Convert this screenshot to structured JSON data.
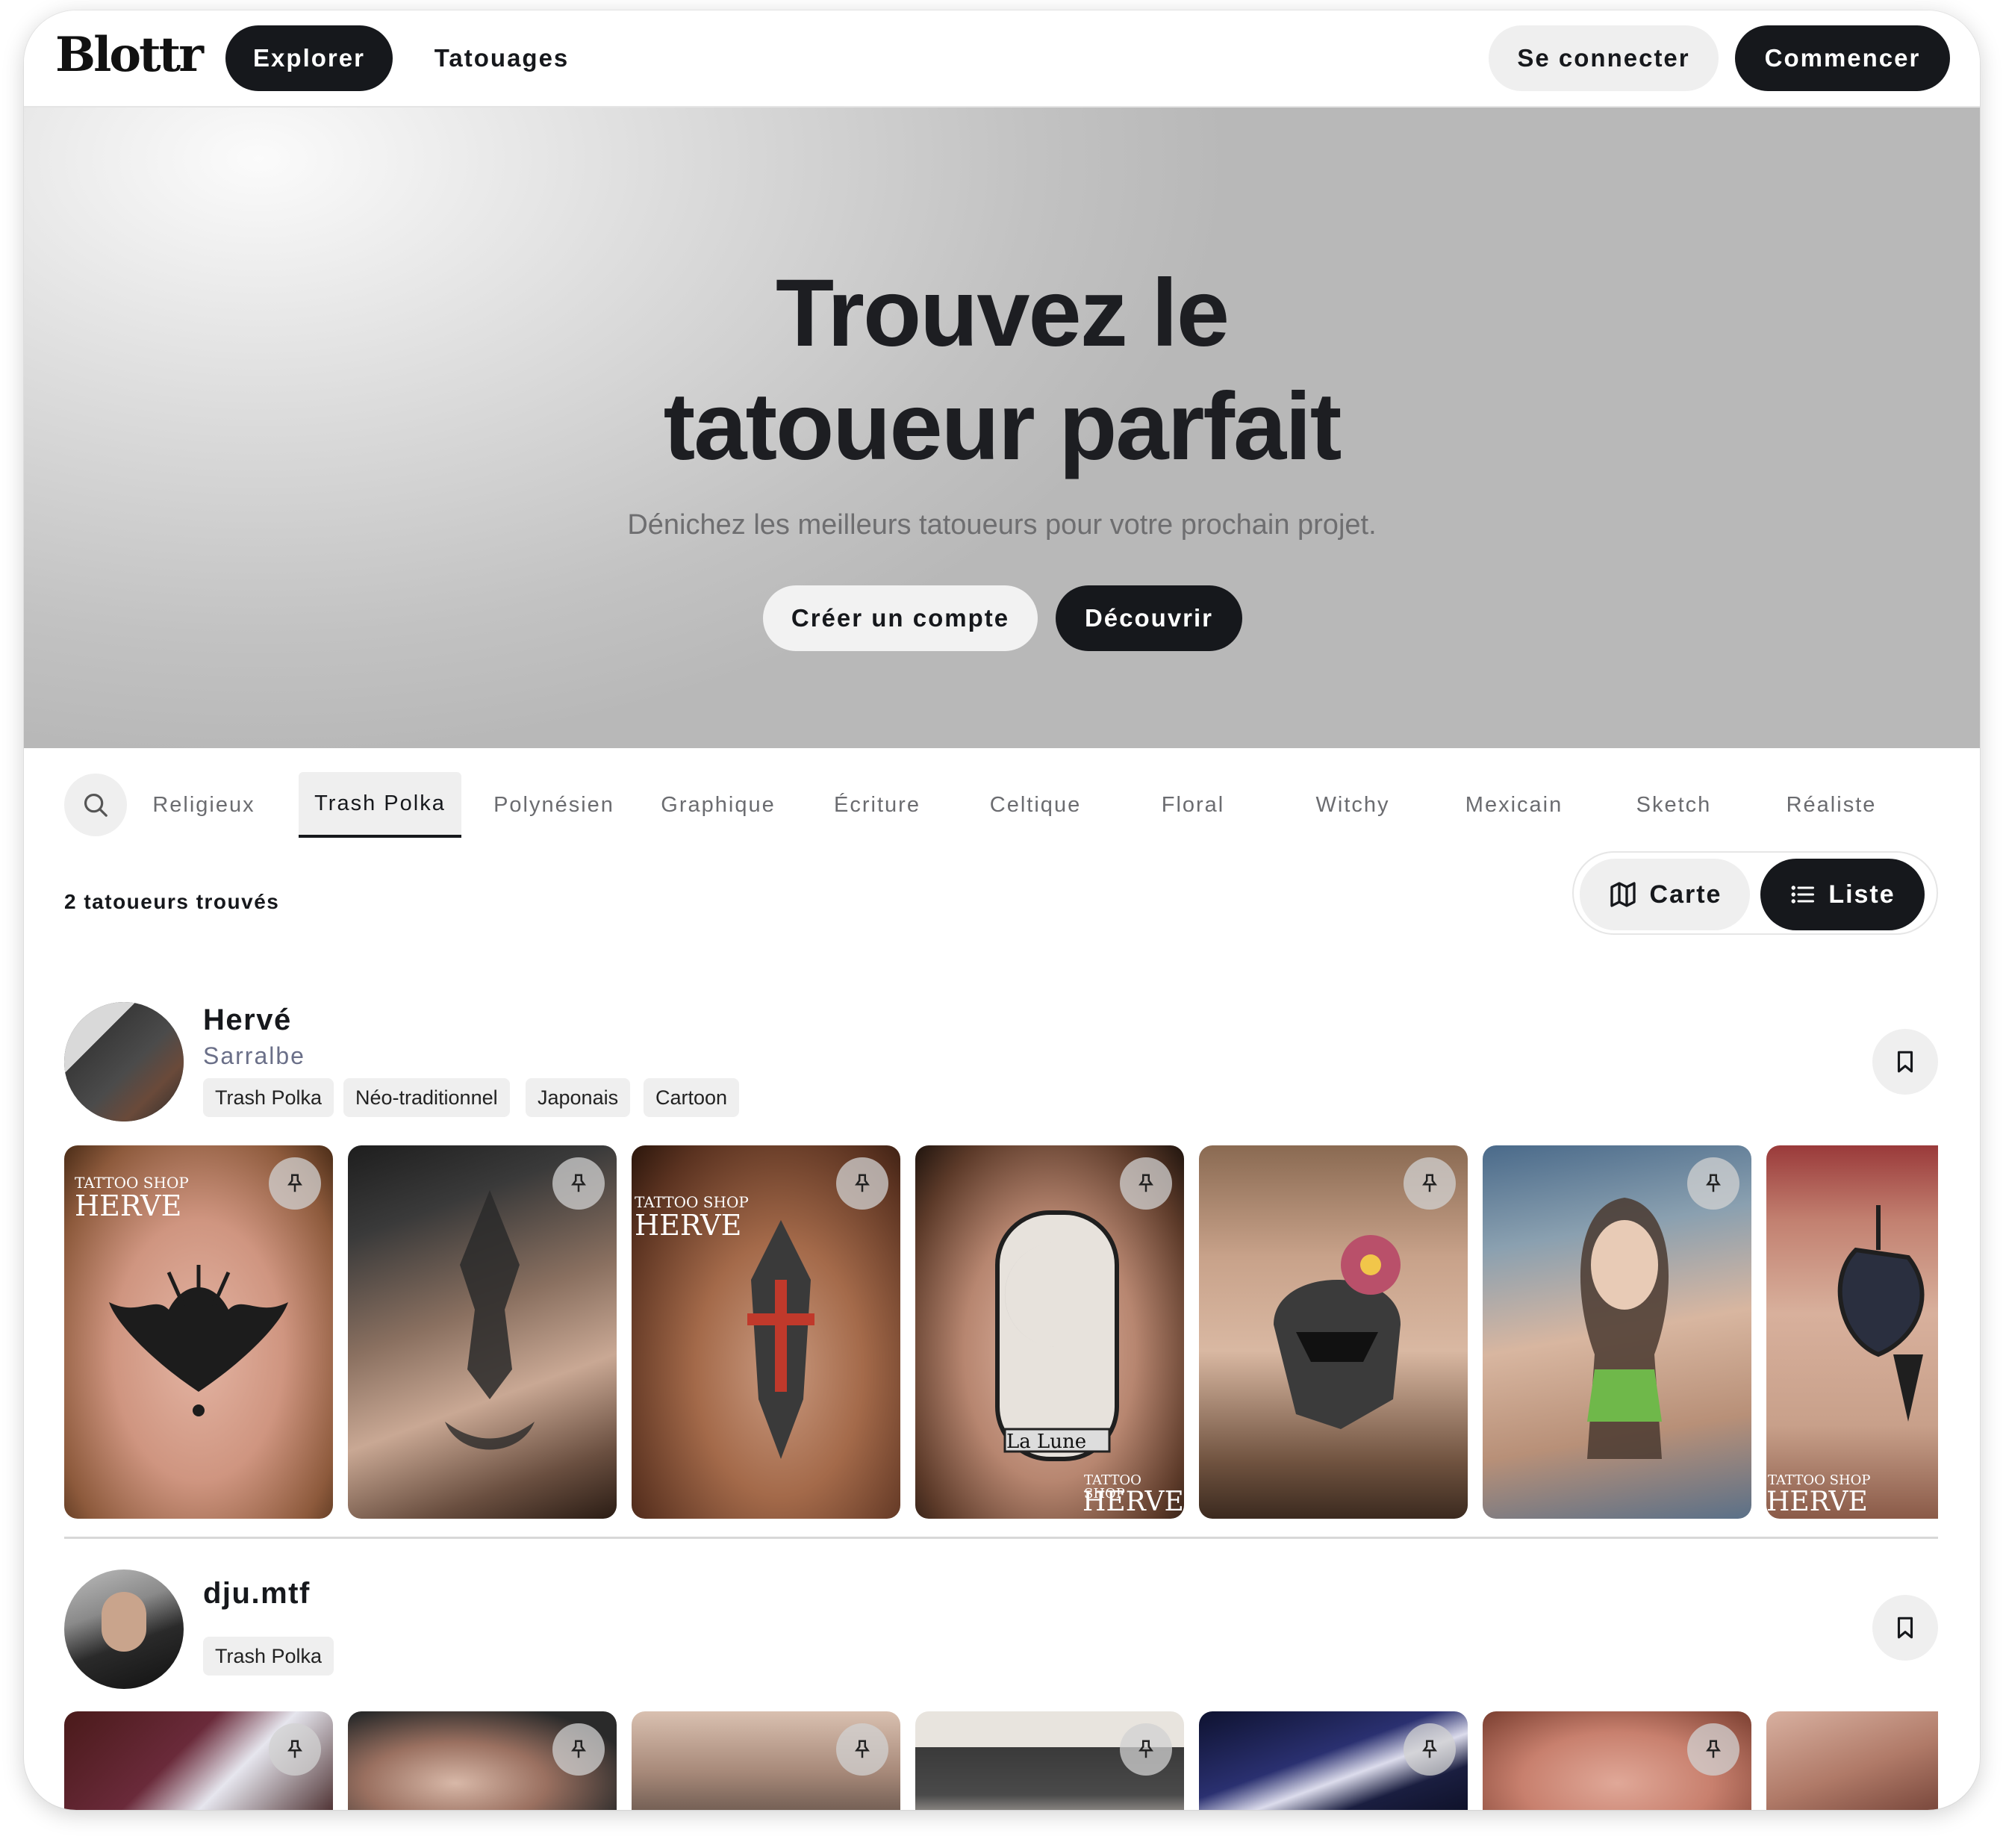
{
  "nav": {
    "logo": "Blottr",
    "explore": "Explorer",
    "tattoos": "Tatouages",
    "login": "Se connecter",
    "start": "Commencer"
  },
  "hero": {
    "title_line1": "Trouvez le",
    "title_line2": "tatoueur parfait",
    "subtitle": "Dénichez les meilleurs tatoueurs pour votre prochain projet.",
    "create_account": "Créer un compte",
    "discover": "Découvrir"
  },
  "categories": {
    "search_icon": "search-icon",
    "items": [
      "Religieux",
      "Trash Polka",
      "Polynésien",
      "Graphique",
      "Écriture",
      "Celtique",
      "Floral",
      "Witchy",
      "Mexicain",
      "Sketch",
      "Réaliste"
    ],
    "active": "Trash Polka"
  },
  "results": {
    "count": "2 tatoueurs trouvés",
    "map": "Carte",
    "list": "Liste",
    "active_view": "Liste"
  },
  "artists": [
    {
      "name": "Hervé",
      "city": "Sarralbe",
      "tags": [
        "Trash Polka",
        "Néo-traditionnel",
        "Japonais",
        "Cartoon"
      ],
      "watermark_shop": "TATTOO SHOP",
      "watermark_name": "HERVE",
      "watermark_text": "La Lune"
    },
    {
      "name": "dju.mtf",
      "tags": [
        "Trash Polka"
      ]
    }
  ],
  "colors": {
    "dark": "#16181c",
    "light_pill": "#efefef",
    "muted_text": "#6b6c70",
    "city_text": "#6a6f88"
  }
}
